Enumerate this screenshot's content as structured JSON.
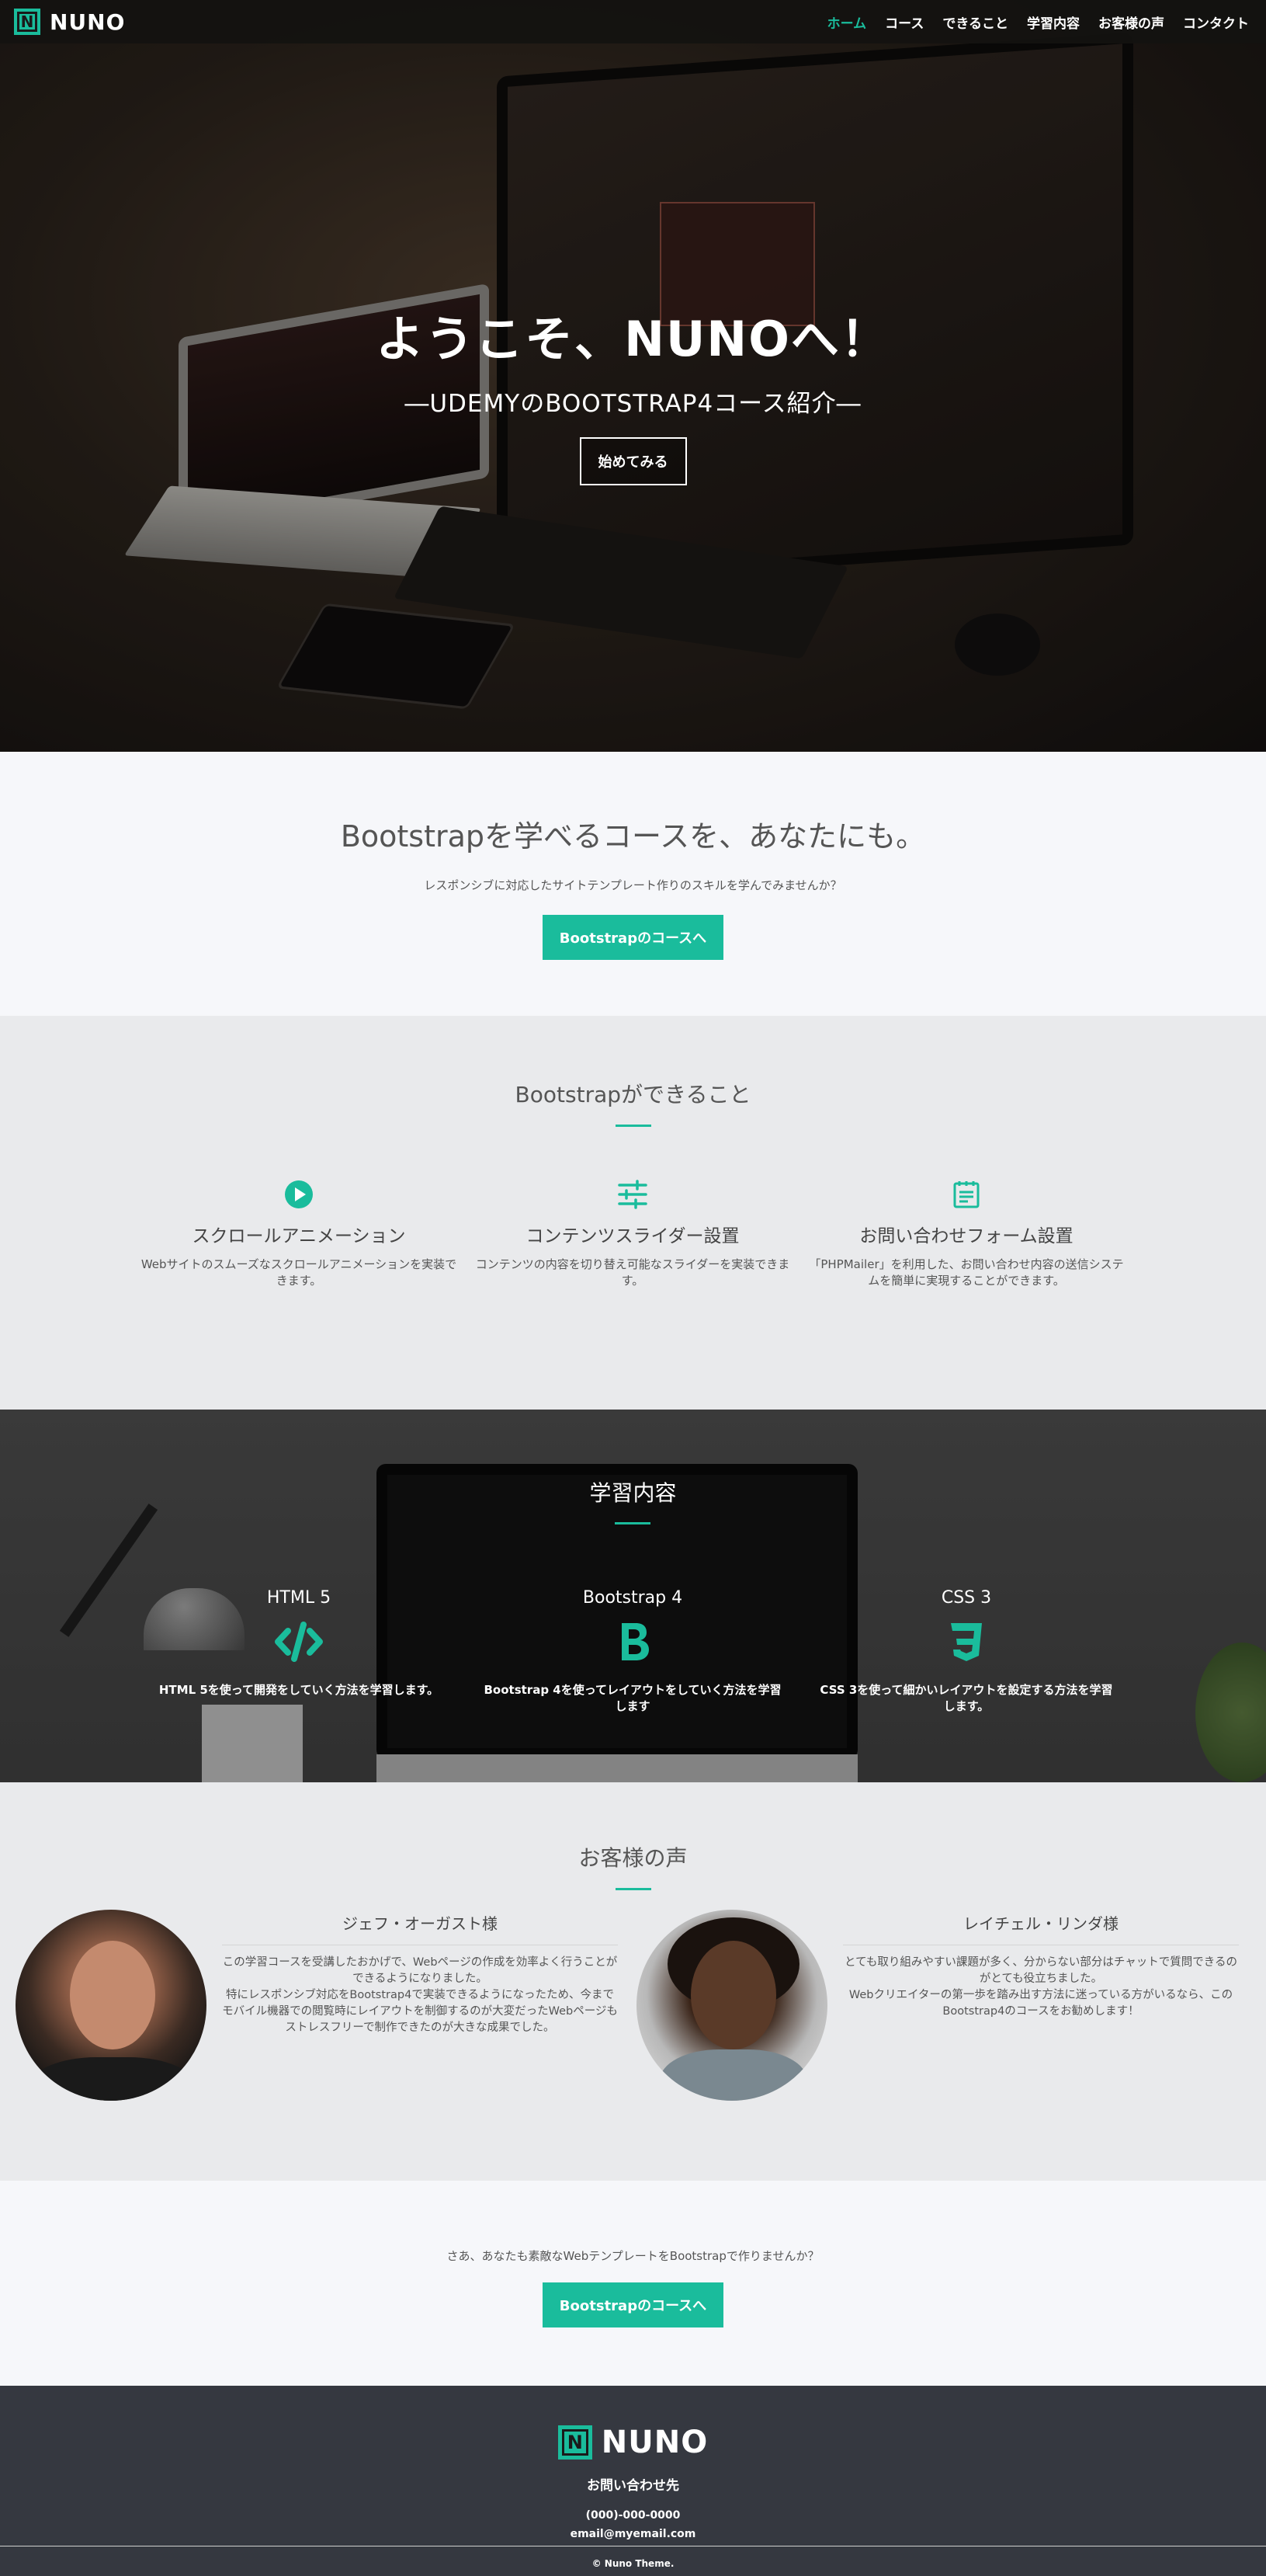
{
  "nav": {
    "brand": "NUNO",
    "brand_letter": "N",
    "items": [
      {
        "label": "ホーム",
        "active": true
      },
      {
        "label": "コース",
        "active": false
      },
      {
        "label": "できること",
        "active": false
      },
      {
        "label": "学習内容",
        "active": false
      },
      {
        "label": "お客様の声",
        "active": false
      },
      {
        "label": "コンタクト",
        "active": false
      }
    ]
  },
  "hero": {
    "title": "ようこそ、NUNOへ！",
    "subtitle": "―UDEMYのBOOTSTRAP4コース紹介―",
    "button": "始めてみる"
  },
  "intro": {
    "title": "Bootstrapを学べるコースを、あなたにも。",
    "text": "レスポンシブに対応したサイトテンプレート作りのスキルを学んでみませんか？",
    "button": "Bootstrapのコースへ"
  },
  "features": {
    "title": "Bootstrapができること",
    "items": [
      {
        "icon": "play-circle-icon",
        "title": "スクロールアニメーション",
        "text": "Webサイトのスムーズなスクロールアニメーションを実装できます。"
      },
      {
        "icon": "sliders-icon",
        "title": "コンテンツスライダー設置",
        "text": "コンテンツの内容を切り替え可能なスライダーを実装できます。"
      },
      {
        "icon": "form-icon",
        "title": "お問い合わせフォーム設置",
        "text": "「PHPMailer」を利用した、お問い合わせ内容の送信システムを簡単に実現することができます。"
      }
    ]
  },
  "learn": {
    "title": "学習内容",
    "items": [
      {
        "icon": "code-icon",
        "title": "HTML 5",
        "text": "HTML 5を使って開発をしていく方法を学習します。"
      },
      {
        "icon": "bootstrap-icon",
        "title": "Bootstrap 4",
        "text": "Bootstrap 4を使ってレイアウトをしていく方法を学習します"
      },
      {
        "icon": "css3-icon",
        "title": "CSS 3",
        "text": "CSS 3を使って細かいレイアウトを設定する方法を学習します。"
      }
    ]
  },
  "voices": {
    "title": "お客様の声",
    "items": [
      {
        "name": "ジェフ・オーガスト様",
        "text1": "この学習コースを受講したおかげで、Webページの作成を効率よく行うことができるようになりました。",
        "text2": "特にレスポンシブ対応をBootstrap4で実装できるようになったため、今までモバイル機器での閲覧時にレイアウトを制御するのが大変だったWebページもストレスフリーで制作できたのが大きな成果でした。"
      },
      {
        "name": "レイチェル・リンダ様",
        "text1": "とても取り組みやすい課題が多く、分からない部分はチャットで質問できるのがとても役立ちました。",
        "text2": "Webクリエイターの第一歩を踏み出す方法に迷っている方がいるなら、このBootstrap4のコースをお勧めします！"
      }
    ]
  },
  "cta": {
    "text": "さあ、あなたも素敵なWebテンプレートをBootstrapで作りませんか？",
    "button": "Bootstrapのコースへ"
  },
  "footer": {
    "brand": "NUNO",
    "brand_letter": "N",
    "contact_title": "お問い合わせ先",
    "phone": "(000)-000-0000",
    "email": "email@myemail.com",
    "copyright": "© Nuno Theme."
  },
  "colors": {
    "accent": "#1abc9c",
    "nav_bg": "#141210",
    "footer_bg": "#353840",
    "section_light": "#f6f7fa",
    "section_gray": "#e9eaec"
  }
}
